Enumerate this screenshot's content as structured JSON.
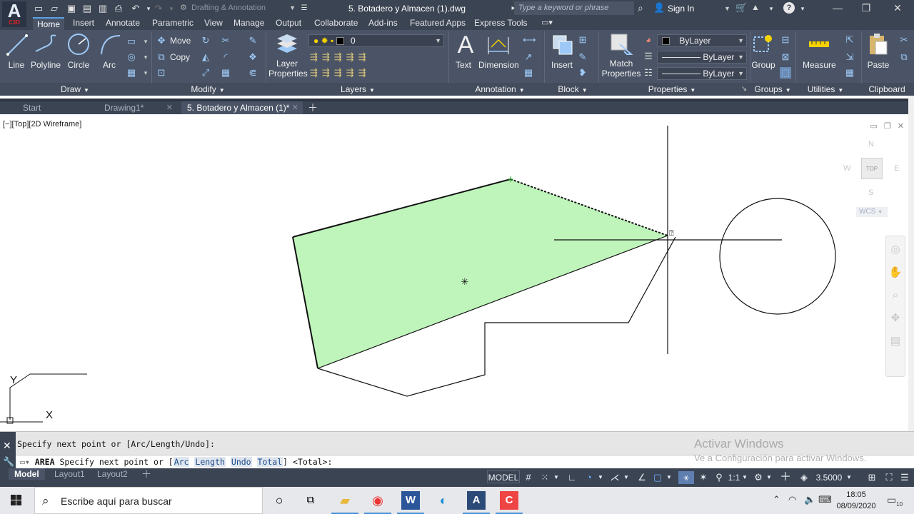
{
  "app": {
    "logo_letter": "A",
    "logo_badge": "C3D",
    "workspace": "Drafting & Annotation",
    "document_title": "5. Botadero y Almacen (1).dwg",
    "search_placeholder": "Type a keyword or phrase",
    "sign_in": "Sign In"
  },
  "ribbon_tabs": [
    "Home",
    "Insert",
    "Annotate",
    "Parametric",
    "View",
    "Manage",
    "Output",
    "Collaborate",
    "Add-ins",
    "Featured Apps",
    "Express Tools"
  ],
  "ribbon": {
    "draw": {
      "line": "Line",
      "polyline": "Polyline",
      "circle": "Circle",
      "arc": "Arc",
      "panel": "Draw"
    },
    "modify": {
      "move": "Move",
      "copy": "Copy",
      "panel": "Modify"
    },
    "layers": {
      "layer_properties_1": "Layer",
      "layer_properties_2": "Properties",
      "current_layer": "0",
      "panel": "Layers"
    },
    "annotation": {
      "text": "Text",
      "dimension": "Dimension",
      "panel": "Annotation"
    },
    "block": {
      "insert": "Insert",
      "panel": "Block"
    },
    "properties": {
      "match_1": "Match",
      "match_2": "Properties",
      "color": "ByLayer",
      "linetype": "ByLayer",
      "lineweight": "ByLayer",
      "panel": "Properties"
    },
    "groups": {
      "group": "Group",
      "panel": "Groups"
    },
    "utilities": {
      "measure": "Measure",
      "panel": "Utilities"
    },
    "clipboard": {
      "paste": "Paste",
      "panel": "Clipboard"
    }
  },
  "file_tabs": [
    {
      "label": "Start"
    },
    {
      "label": "Drawing1*"
    },
    {
      "label": "5. Botadero y Almacen (1)*"
    }
  ],
  "viewport": {
    "label": "[−][Top][2D Wireframe]",
    "viewcube_top": "TOP",
    "compass_n": "N",
    "compass_s": "S",
    "compass_e": "E",
    "compass_w": "W",
    "wcs": "WCS",
    "ucs_x": "X",
    "ucs_y": "Y"
  },
  "command": {
    "history": "Specify next point or [Arc/Length/Undo]:",
    "prefix": "AREA",
    "prompt_start": "Specify next point or [",
    "options": [
      "Arc",
      "Length",
      "Undo",
      "Total"
    ],
    "prompt_end": "] <Total>:"
  },
  "watermark": {
    "line1": "Activar Windows",
    "line2": "Ve a Configuración para activar Windows."
  },
  "layout_tabs": [
    "Model",
    "Layout1",
    "Layout2"
  ],
  "status": {
    "model": "MODEL",
    "scale": "1:1",
    "value": "3.5000"
  },
  "taskbar": {
    "search": "Escribe aquí para buscar",
    "time": "18:05",
    "date": "08/09/2020",
    "notifications": "10"
  },
  "colors": {
    "title_bar": "#3b4453",
    "ribbon": "#4a5466",
    "area_fill": "#bff5bb",
    "accent": "#5aa0e6"
  }
}
